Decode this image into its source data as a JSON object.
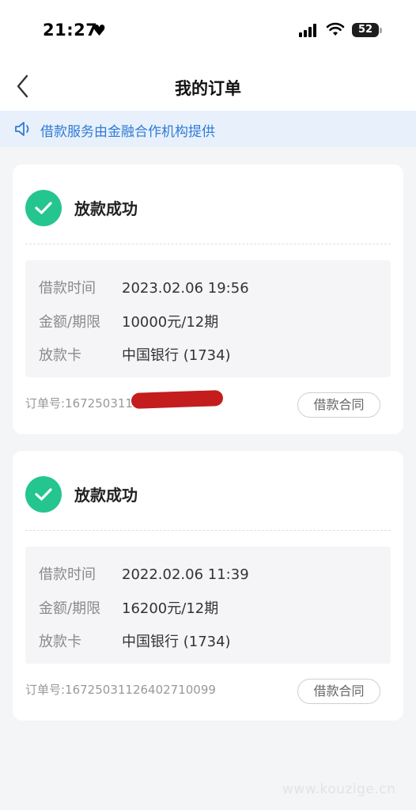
{
  "status_bar": {
    "time": "21:27",
    "battery": "52"
  },
  "nav": {
    "title": "我的订单"
  },
  "notice": {
    "text": "借款服务由金融合作机构提供"
  },
  "orders": [
    {
      "status": "放款成功",
      "rows": [
        {
          "label": "借款时间",
          "value": "2023.02.06 19:56"
        },
        {
          "label": "金额/期限",
          "value": "10000元/12期"
        },
        {
          "label": "放款卡",
          "value": "中国银行 (1734)"
        }
      ],
      "order_no": "订单号:1672503110",
      "contract_label": "借款合同"
    },
    {
      "status": "放款成功",
      "rows": [
        {
          "label": "借款时间",
          "value": "2022.02.06 11:39"
        },
        {
          "label": "金额/期限",
          "value": "16200元/12期"
        },
        {
          "label": "放款卡",
          "value": "中国银行 (1734)"
        }
      ],
      "order_no": "订单号:16725031126402710099",
      "contract_label": "借款合同"
    }
  ],
  "watermark": "www.kouzige.cn",
  "colors": {
    "accent": "#2f7ad6",
    "success": "#25c58f",
    "redaction": "#c41d1d"
  }
}
